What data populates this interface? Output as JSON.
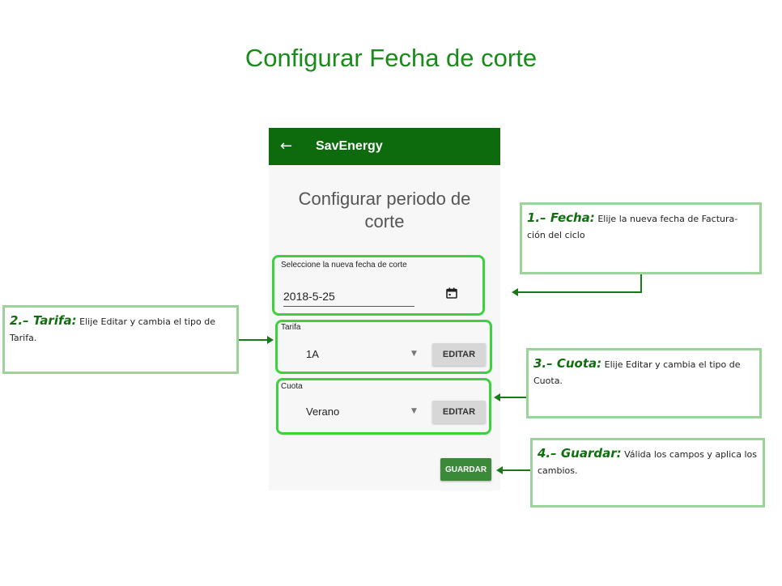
{
  "slide": {
    "title": "Configurar Fecha de corte"
  },
  "app": {
    "title": "SavEnergy",
    "screen_title": "Configurar periodo de corte",
    "date": {
      "label": "Seleccione la nueva fecha de corte",
      "value": "2018-5-25"
    },
    "tarifa": {
      "label": "Tarifa",
      "value": "1A",
      "edit_label": "EDITAR"
    },
    "cuota": {
      "label": "Cuota",
      "value": "Verano",
      "edit_label": "EDITAR"
    },
    "save_label": "GUARDAR"
  },
  "callouts": [
    {
      "heading": "1.– Fecha:",
      "text": "Elije la nueva fecha de Factura-ción del ciclo"
    },
    {
      "heading": "2.– Tarifa:",
      "text": "Elije Editar y cambia el tipo de Tarifa."
    },
    {
      "heading": "3.– Cuota:",
      "text": "Elije Editar y cambia el tipo de Cuota."
    },
    {
      "heading": "4.– Guardar:",
      "text": "Válida los campos y aplica los cambios."
    }
  ],
  "colors": {
    "appbar": "#0d6b0d",
    "highlight": "#3ed13e",
    "callout_border": "#9bd39b",
    "accent": "#1a8a1a"
  },
  "icons": {
    "back": "arrow-left-icon",
    "calendar": "calendar-icon",
    "dropdown": "caret-down-icon"
  }
}
